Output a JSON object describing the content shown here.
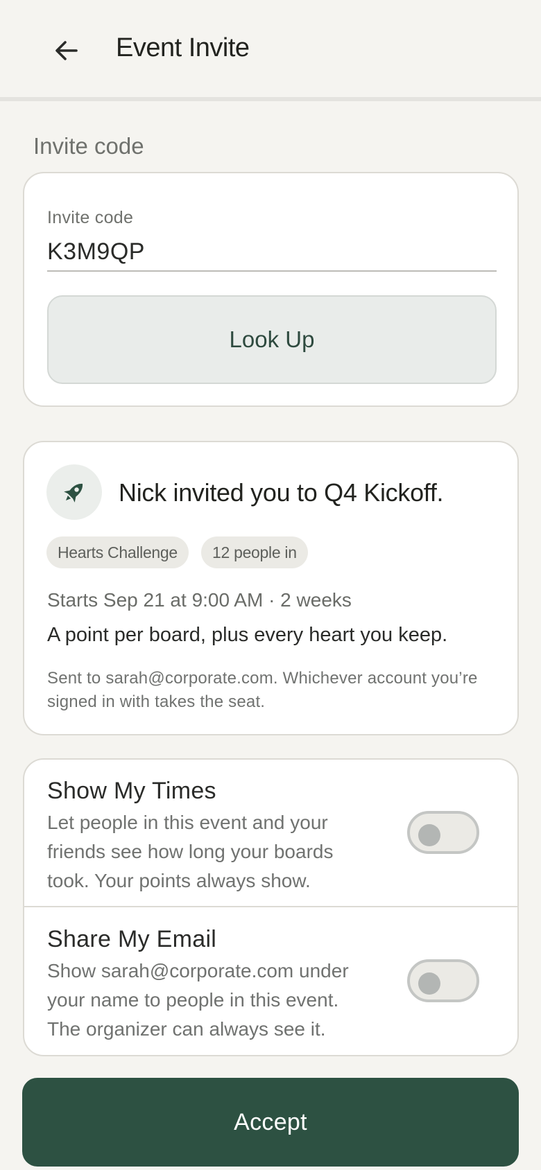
{
  "header": {
    "title": "Event Invite",
    "back_icon": "arrow-left-icon"
  },
  "invite_code_section": {
    "label": "Invite code",
    "field_label": "Invite code",
    "value": "K3M9QP",
    "lookup_label": "Look Up"
  },
  "invite": {
    "icon": "rocket-icon",
    "title": "Nick invited you to Q4 Kickoff.",
    "chips": [
      "Hearts Challenge",
      "12 people in"
    ],
    "starts": "Starts Sep 21 at 9:00 AM · 2 weeks",
    "description": "A point per board, plus every heart you keep.",
    "note": "Sent to sarah@corporate.com. Whichever account you’re signed in with takes the seat."
  },
  "preferences": [
    {
      "title": "Show My Times",
      "description": "Let people in this event and your friends see how long your boards took. Your points always show.",
      "enabled": false
    },
    {
      "title": "Share My Email",
      "description": "Show sarah@corporate.com under your name to people in this event. The organizer can always see it.",
      "enabled": false
    }
  ],
  "accept_label": "Accept",
  "colors": {
    "background": "#f5f4f0",
    "accent": "#2d5142",
    "card": "#ffffff"
  }
}
